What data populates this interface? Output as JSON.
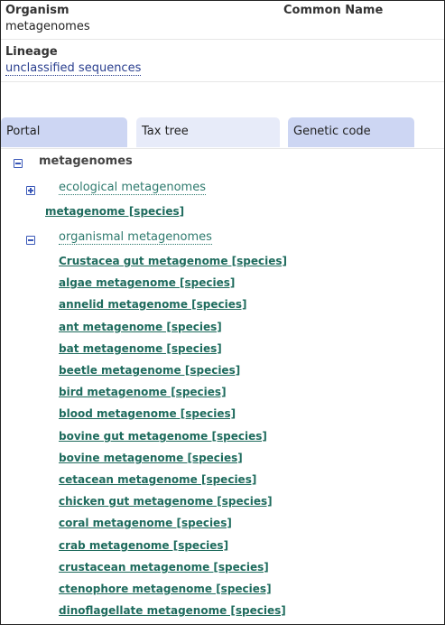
{
  "header": {
    "organism_label": "Organism",
    "organism_value": "metagenomes",
    "common_name_label": "Common Name",
    "lineage_label": "Lineage",
    "lineage_link": "unclassified sequences"
  },
  "tabs": [
    {
      "label": "Portal"
    },
    {
      "label": "Tax tree"
    },
    {
      "label": "Genetic code"
    }
  ],
  "tree": {
    "root": "metagenomes",
    "ecological_group": "ecological metagenomes",
    "metagenome_species": "metagenome [species]",
    "organismal_group": "organismal metagenomes",
    "species": [
      "Crustacea gut metagenome [species]",
      "algae metagenome [species]",
      "annelid metagenome [species]",
      "ant metagenome [species]",
      "bat metagenome [species]",
      "beetle metagenome [species]",
      "bird metagenome [species]",
      "blood metagenome [species]",
      "bovine gut metagenome [species]",
      "bovine metagenome [species]",
      "cetacean metagenome [species]",
      "chicken gut metagenome [species]",
      "coral metagenome [species]",
      "crab metagenome [species]",
      "crustacean metagenome [species]",
      "ctenophore metagenome [species]",
      "dinoflagellate metagenome [species]"
    ]
  }
}
